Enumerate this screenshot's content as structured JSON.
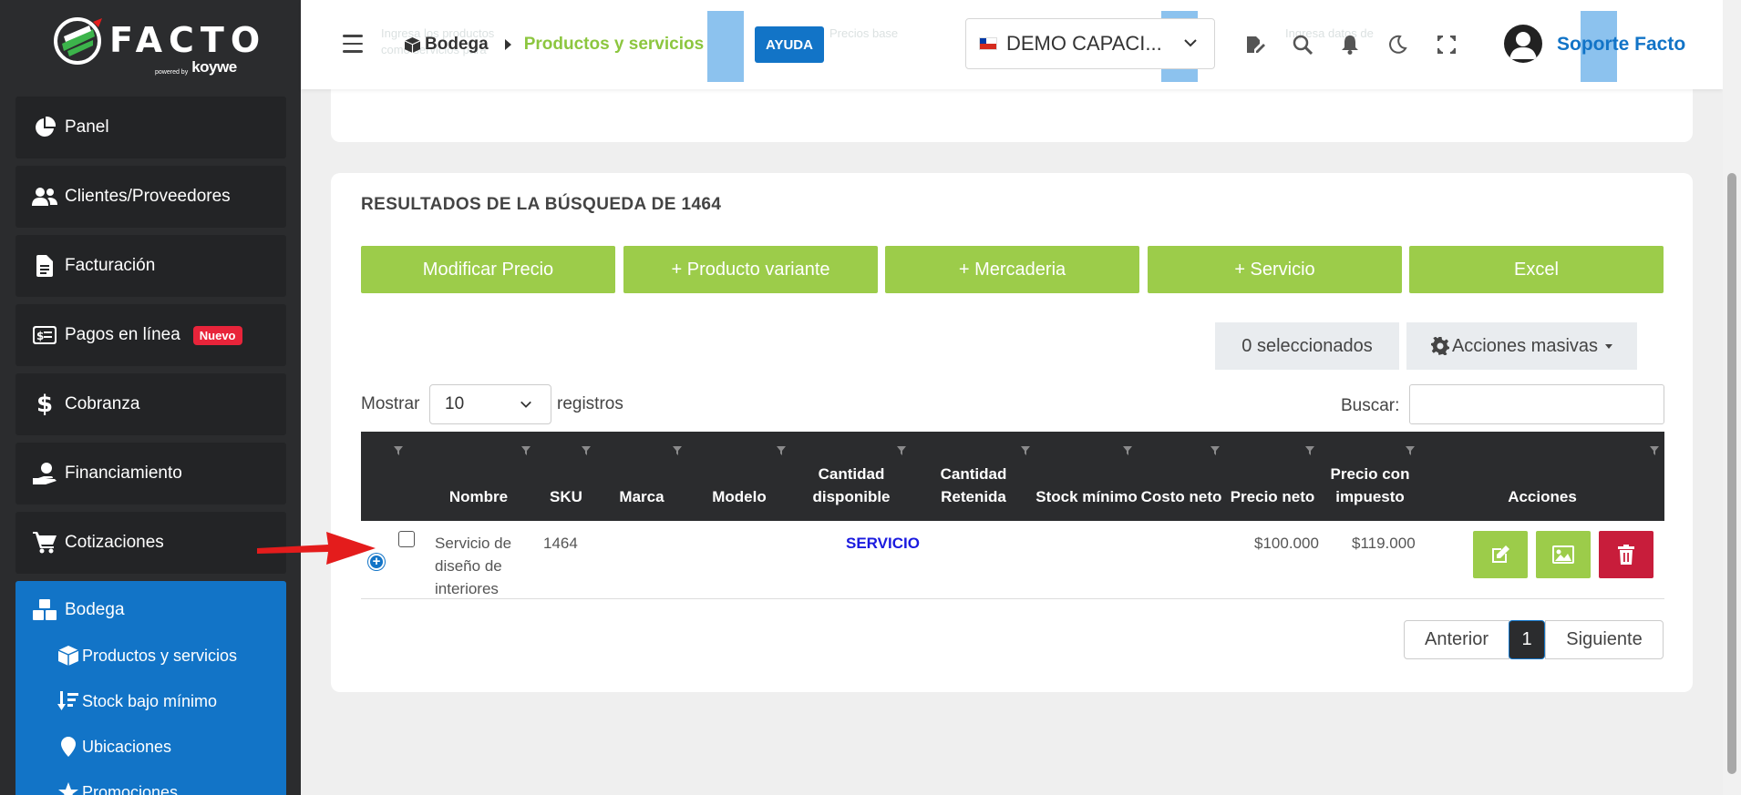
{
  "app": {
    "brand": "FACTO",
    "powered_by": "powered by",
    "powered_brand": "koywe"
  },
  "sidebar": {
    "items": [
      {
        "label": "Panel",
        "icon": "pie-chart-icon"
      },
      {
        "label": "Clientes/Proveedores",
        "icon": "users-icon"
      },
      {
        "label": "Facturación",
        "icon": "document-icon"
      },
      {
        "label": "Pagos en línea",
        "icon": "money-bill-icon",
        "badge": "Nuevo"
      },
      {
        "label": "Cobranza",
        "icon": "dollar-icon"
      },
      {
        "label": "Financiamiento",
        "icon": "hand-coin-icon"
      },
      {
        "label": "Cotizaciones",
        "icon": "cart-icon"
      }
    ],
    "active_group": {
      "label": "Bodega",
      "icon": "boxes-icon",
      "children": [
        {
          "label": "Productos y servicios",
          "icon": "box-icon"
        },
        {
          "label": "Stock bajo mínimo",
          "icon": "sort-down-icon"
        },
        {
          "label": "Ubicaciones",
          "icon": "map-pin-icon"
        },
        {
          "label": "Promociones",
          "icon": "star-icon"
        }
      ]
    }
  },
  "header": {
    "breadcrumb": [
      "Bodega",
      "Productos y servicios"
    ],
    "help_label": "AYUDA",
    "company": "DEMO CAPACI...",
    "user_name": "Soporte Facto",
    "ghost_text": [
      "Ingresa los productos",
      "como servicios para",
      "Precios base",
      "Ingresa datos de"
    ]
  },
  "results": {
    "title": "RESULTADOS DE LA BÚSQUEDA DE 1464",
    "buttons": [
      "Modificar Precio",
      "+ Producto variante",
      "+ Mercaderia",
      "+ Servicio",
      "Excel"
    ],
    "selected_count": "0 seleccionados",
    "bulk_actions": "Acciones masivas",
    "show_label": "Mostrar",
    "show_value": "10",
    "records_label": "registros",
    "search_label": "Buscar:",
    "search_value": ""
  },
  "table": {
    "columns": [
      "",
      "Nombre",
      "SKU",
      "Marca",
      "Modelo",
      "Cantidad disponible",
      "Cantidad Retenida",
      "Stock mínimo",
      "Costo neto",
      "Precio neto",
      "Precio con impuesto",
      "Acciones"
    ],
    "rows": [
      {
        "nombre": "Servicio de diseño de interiores",
        "sku": "1464",
        "marca": "",
        "modelo": "",
        "cantidad_disponible": "SERVICIO",
        "cantidad_retenida": "",
        "stock_minimo": "",
        "costo_neto": "",
        "precio_neto": "$100.000",
        "precio_con_impuesto": "$119.000"
      }
    ]
  },
  "pagination": {
    "prev": "Anterior",
    "current": "1",
    "next": "Siguiente"
  },
  "colors": {
    "sidebar_bg": "#2b2c2e",
    "active_blue": "#1274c7",
    "green": "#9ccc4a",
    "breadcrumb_green": "#8cc63f",
    "danger": "#c81d3b",
    "annotation_arrow": "#e41c1c"
  }
}
